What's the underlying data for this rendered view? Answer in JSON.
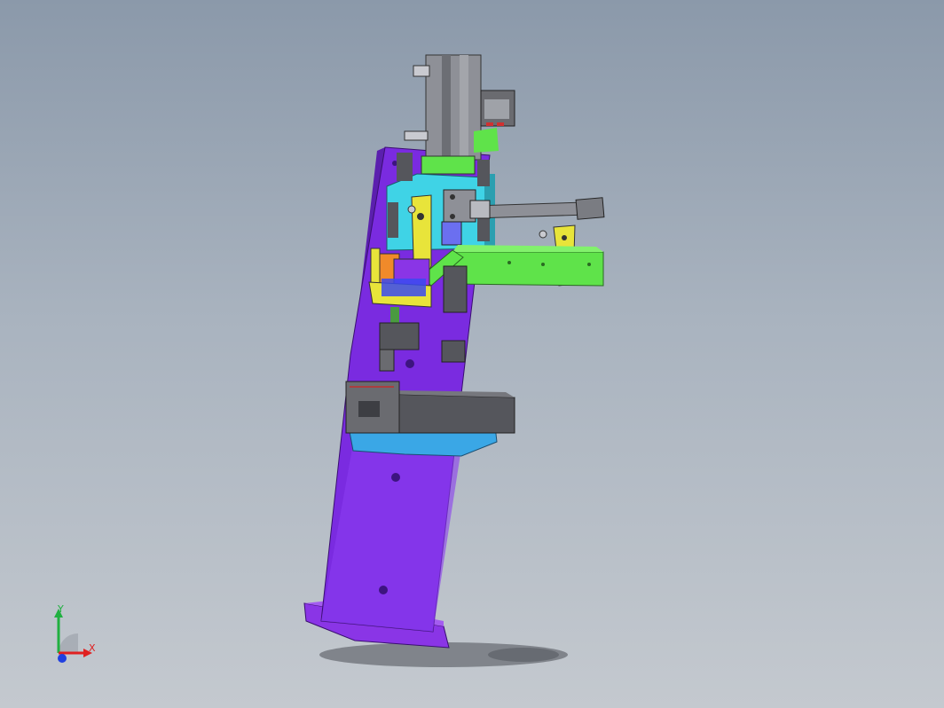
{
  "viewport": {
    "background": "#a9b3bf"
  },
  "model": {
    "colors": {
      "column": "#7a2be0",
      "column_side": "#5b1fae",
      "base_plate": "#8a35e6",
      "cyan_block": "#3fd3e6",
      "green_arm": "#5fe34a",
      "yellow_bracket": "#e8e43a",
      "dark_gray": "#55565c",
      "light_blue": "#3aa7e6",
      "orange_block": "#f08a2a",
      "cylinder_gray": "#8e9097",
      "display_red": "#d03030"
    }
  },
  "triad": {
    "x_label": "X",
    "y_label": "Y",
    "colors": {
      "x": "#e02020",
      "y": "#20b040",
      "z": "#2040e0"
    }
  }
}
